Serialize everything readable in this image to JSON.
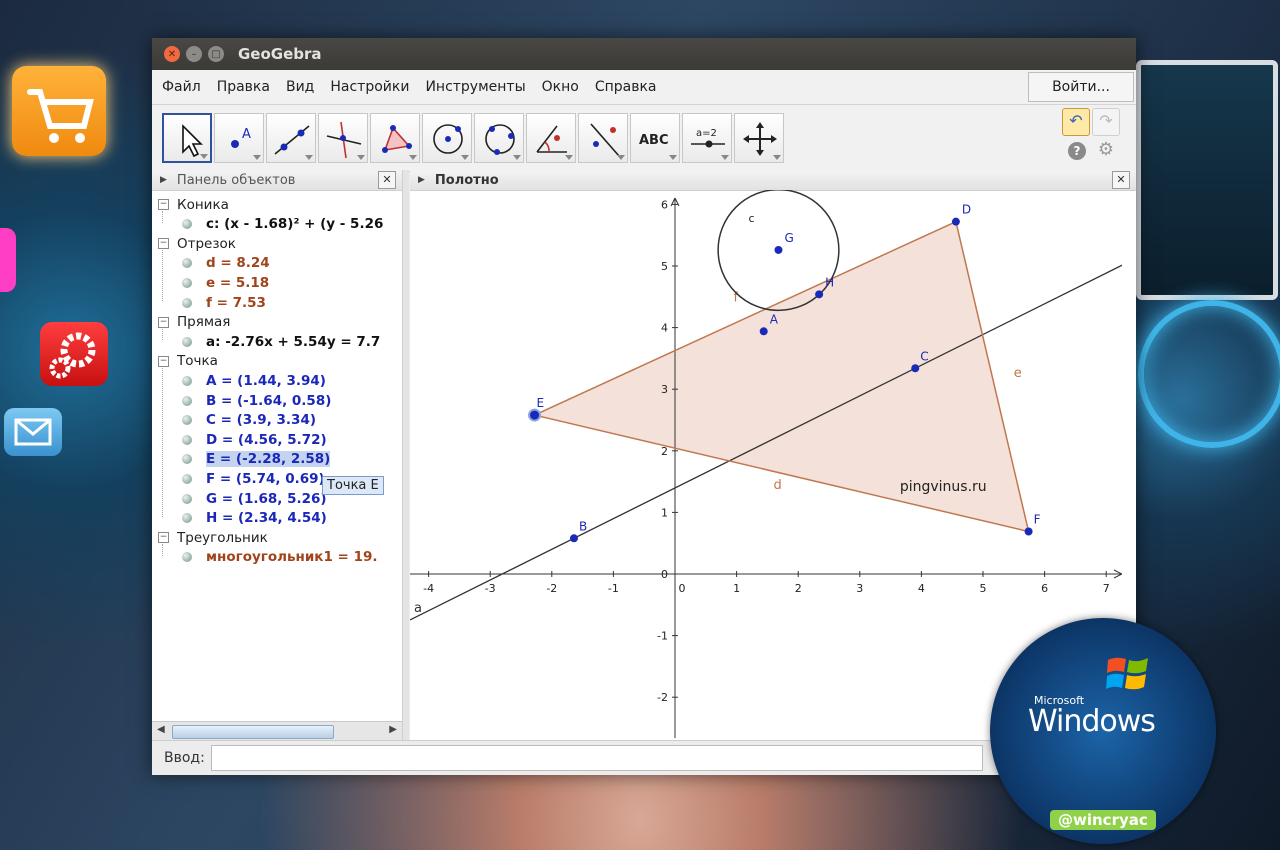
{
  "window": {
    "title": "GeoGebra",
    "menu": [
      "Файл",
      "Правка",
      "Вид",
      "Настройки",
      "Инструменты",
      "Окно",
      "Справка"
    ],
    "login_label": "Войти...",
    "toolbar": {
      "tools": [
        "move-tool",
        "point-tool",
        "line-tool",
        "perpendicular-line-tool",
        "polygon-tool",
        "circle-center-point-tool",
        "circle-three-points-tool",
        "angle-tool",
        "reflect-tool",
        "text-tool",
        "slider-tool",
        "move-graphics-view-tool"
      ],
      "text_tool_label": "ABC",
      "slider_tool_label": "a=2"
    }
  },
  "algebra_panel": {
    "title": "Панель объектов",
    "groups": [
      {
        "name": "Коника",
        "items": [
          {
            "text": "c: (x - 1.68)² + (y - 5.26",
            "color": "#111111"
          }
        ]
      },
      {
        "name": "Отрезок",
        "items": [
          {
            "text": "d = 8.24",
            "color": "#a0441b"
          },
          {
            "text": "e = 5.18",
            "color": "#a0441b"
          },
          {
            "text": "f = 7.53",
            "color": "#a0441b"
          }
        ]
      },
      {
        "name": "Прямая",
        "items": [
          {
            "text": "a: -2.76x + 5.54y = 7.7",
            "color": "#111111"
          }
        ]
      },
      {
        "name": "Точка",
        "items": [
          {
            "text": "A = (1.44, 3.94)",
            "color": "#1a27b8"
          },
          {
            "text": "B = (-1.64, 0.58)",
            "color": "#1a27b8"
          },
          {
            "text": "C = (3.9, 3.34)",
            "color": "#1a27b8"
          },
          {
            "text": "D = (4.56, 5.72)",
            "color": "#1a27b8"
          },
          {
            "text": "E = (-2.28, 2.58)",
            "color": "#1a27b8"
          },
          {
            "text": "F = (5.74, 0.69)",
            "color": "#1a27b8"
          },
          {
            "text": "G = (1.68, 5.26)",
            "color": "#1a27b8"
          },
          {
            "text": "H = (2.34, 4.54)",
            "color": "#1a27b8"
          }
        ]
      },
      {
        "name": "Треугольник",
        "items": [
          {
            "text": "многоугольник1 = 19.",
            "color": "#a0441b"
          }
        ]
      }
    ],
    "tooltip": "Точка E"
  },
  "graphics_panel": {
    "title": "Полотно",
    "x_ticks": [
      "-4",
      "-3",
      "-2",
      "-1",
      "0",
      "1",
      "2",
      "3",
      "4",
      "5",
      "6",
      "7"
    ],
    "y_ticks": [
      "6",
      "5",
      "4",
      "3",
      "2",
      "1",
      "0",
      "-1",
      "-2"
    ],
    "points": [
      {
        "name": "A",
        "x": 1.44,
        "y": 3.94
      },
      {
        "name": "B",
        "x": -1.64,
        "y": 0.58
      },
      {
        "name": "C",
        "x": 3.9,
        "y": 3.34
      },
      {
        "name": "D",
        "x": 4.56,
        "y": 5.72
      },
      {
        "name": "E",
        "x": -2.28,
        "y": 2.58
      },
      {
        "name": "F",
        "x": 5.74,
        "y": 0.69
      },
      {
        "name": "G",
        "x": 1.68,
        "y": 5.26
      },
      {
        "name": "H",
        "x": 2.34,
        "y": 4.54
      }
    ],
    "circle": {
      "name": "c",
      "cx": 1.68,
      "cy": 5.26,
      "r": 0.98
    },
    "line_label": "a",
    "segment_labels": {
      "d": "d",
      "e": "e",
      "f": "f"
    },
    "watermark": "pingvinus.ru",
    "colors": {
      "polygon_fill": "#f2dcd2",
      "segment": "#c0774e",
      "point": "#1a2ab8",
      "line": "#333333"
    }
  },
  "input_bar": {
    "label": "Ввод:"
  },
  "badge": {
    "brand_small": "Microsoft",
    "brand_large": "Windows",
    "tag": "@wincryac"
  }
}
